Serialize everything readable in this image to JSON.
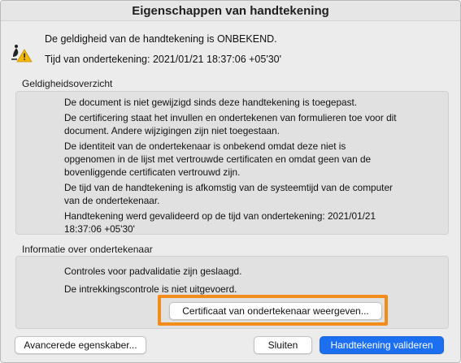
{
  "window": {
    "title": "Eigenschappen van handtekening"
  },
  "status": {
    "validity": "De geldigheid van de handtekening is ONBEKEND.",
    "signing_time": "Tijd van ondertekening: 2021/01/21 18:37:06 +05'30'"
  },
  "summary": {
    "label": "Geldigheidsoverzicht",
    "paragraphs": [
      "De document is niet gewijzigd sinds deze handtekening is toegepast.",
      "De certificering staat het invullen en ondertekenen van formulieren toe voor dit document. Andere wijzigingen zijn niet toegestaan.",
      "De identiteit van de ondertekenaar is onbekend omdat deze niet is opgenomen in de lijst met vertrouwde certificaten en omdat geen van de bovenliggende certificaten vertrouwd zijn.",
      "De tijd van de handtekening is afkomstig van de systeemtijd van de computer van de ondertekenaar.",
      "Handtekening werd gevalideerd op de tijd van ondertekening: 2021/01/21 18:37:06 +05'30'"
    ]
  },
  "signer_info": {
    "label": "Informatie over ondertekenaar",
    "path_validation": "Controles voor padvalidatie zijn geslaagd.",
    "revocation": "De intrekkingscontrole is niet uitgevoerd.",
    "show_certificate_button": "Certificaat van ondertekenaar weergeven..."
  },
  "footer": {
    "advanced_button": "Avancerede egenskaber...",
    "close_button": "Sluiten",
    "validate_button": "Handtekening valideren"
  },
  "colors": {
    "highlight": "#f28d1c",
    "primary_button": "#1d6ff2",
    "warning": "#f5b800"
  },
  "icons": {
    "signer_status": "signature-warning-icon"
  }
}
